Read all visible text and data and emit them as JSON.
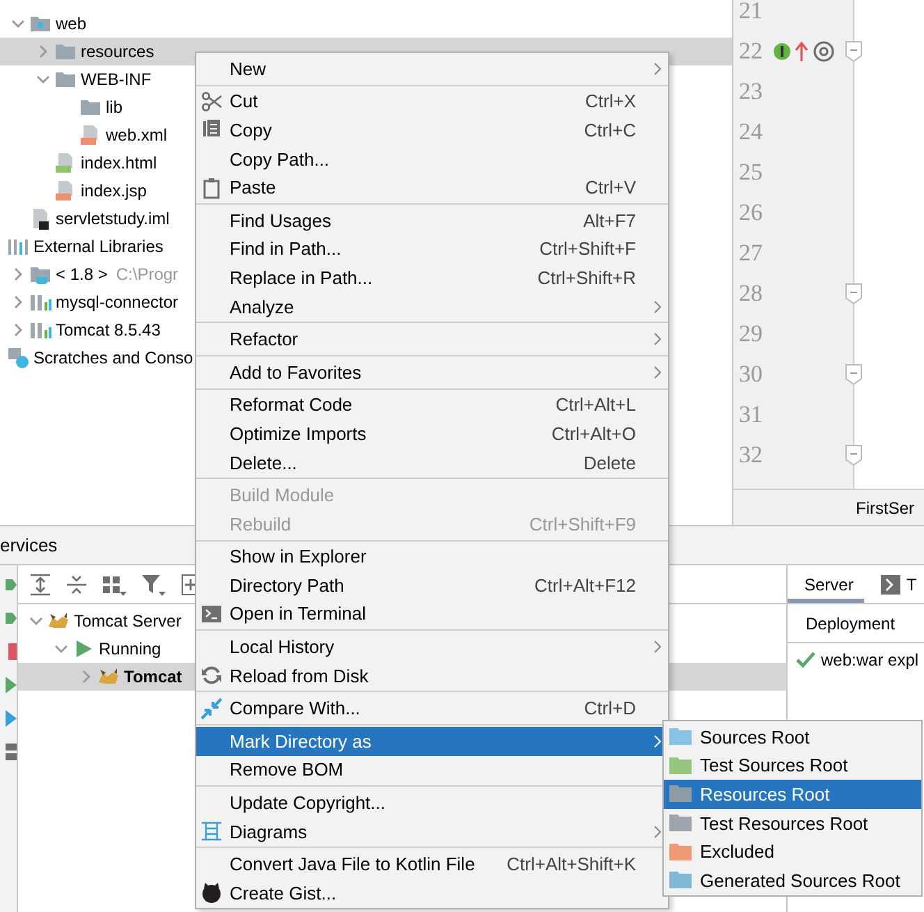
{
  "project_tree": [
    {
      "label": "web",
      "kind": "web-folder",
      "expanded": true,
      "selected": false,
      "children": [
        {
          "label": "resources",
          "kind": "folder",
          "expanded": false,
          "selected": true
        },
        {
          "label": "WEB-INF",
          "kind": "folder",
          "expanded": true,
          "selected": false,
          "children": [
            {
              "label": "lib",
              "kind": "folder",
              "selected": false
            },
            {
              "label": "web.xml",
              "kind": "xml",
              "selected": false
            }
          ]
        },
        {
          "label": "index.html",
          "kind": "html",
          "selected": false
        },
        {
          "label": "index.jsp",
          "kind": "jsp",
          "selected": false
        }
      ]
    },
    {
      "label": "servletstudy.iml",
      "kind": "iml",
      "selected": false
    },
    {
      "label": "External Libraries",
      "kind": "libraries",
      "selected": false,
      "children": [
        {
          "label": "< 1.8 >",
          "detail": "C:\\Progr",
          "kind": "jdk",
          "expanded": false,
          "selected": false
        },
        {
          "label": "mysql-connector",
          "kind": "library",
          "expanded": false,
          "selected": false
        },
        {
          "label": "Tomcat 8.5.43",
          "kind": "library",
          "expanded": false,
          "selected": false
        }
      ]
    },
    {
      "label": "Scratches and Conso",
      "kind": "scratches",
      "selected": false
    }
  ],
  "editor": {
    "lines": [
      {
        "number": "21",
        "fold": false,
        "annotated": false
      },
      {
        "number": "22",
        "fold": true,
        "annotated": true
      },
      {
        "number": "23",
        "fold": false,
        "annotated": false
      },
      {
        "number": "24",
        "fold": false,
        "annotated": false
      },
      {
        "number": "25",
        "fold": false,
        "annotated": false
      },
      {
        "number": "26",
        "fold": false,
        "annotated": false
      },
      {
        "number": "27",
        "fold": false,
        "annotated": false
      },
      {
        "number": "28",
        "fold": true,
        "annotated": false
      },
      {
        "number": "29",
        "fold": false,
        "annotated": false
      },
      {
        "number": "30",
        "fold": true,
        "annotated": false
      },
      {
        "number": "31",
        "fold": false,
        "annotated": false
      },
      {
        "number": "32",
        "fold": true,
        "annotated": false
      }
    ],
    "tab": "FirstSer"
  },
  "services": {
    "title": "ervices",
    "tree": [
      {
        "label": "Tomcat Server",
        "kind": "tomcat",
        "expanded": true,
        "bold": false,
        "selected": false,
        "children": [
          {
            "label": "Running",
            "kind": "running",
            "expanded": true,
            "bold": false,
            "selected": false,
            "children": [
              {
                "label": "Tomcat",
                "kind": "tomcat",
                "expanded": false,
                "bold": true,
                "selected": true
              }
            ]
          }
        ]
      }
    ],
    "tabs": [
      {
        "label": "Server",
        "selected": true
      },
      {
        "label": "T",
        "selected": false
      }
    ],
    "deployment_header": "Deployment",
    "deployments": [
      {
        "label": "web:war expl"
      }
    ]
  },
  "context_menu": {
    "groups": [
      {
        "items": [
          {
            "label": "New",
            "kind": "plain",
            "submenu": true,
            "disabled": false,
            "selected": false
          }
        ]
      },
      {
        "items": [
          {
            "label": "Cut",
            "shortcut": "Ctrl+X",
            "kind": "cut",
            "submenu": false,
            "disabled": false,
            "selected": false
          },
          {
            "label": "Copy",
            "shortcut": "Ctrl+C",
            "kind": "copy",
            "submenu": false,
            "disabled": false,
            "selected": false
          },
          {
            "label": "Copy Path...",
            "kind": "plain",
            "submenu": false,
            "disabled": false,
            "selected": false
          },
          {
            "label": "Paste",
            "shortcut": "Ctrl+V",
            "kind": "paste",
            "submenu": false,
            "disabled": false,
            "selected": false
          }
        ]
      },
      {
        "items": [
          {
            "label": "Find Usages",
            "shortcut": "Alt+F7",
            "kind": "plain",
            "submenu": false,
            "disabled": false,
            "selected": false
          },
          {
            "label": "Find in Path...",
            "shortcut": "Ctrl+Shift+F",
            "kind": "plain",
            "submenu": false,
            "disabled": false,
            "selected": false
          },
          {
            "label": "Replace in Path...",
            "shortcut": "Ctrl+Shift+R",
            "kind": "plain",
            "submenu": false,
            "disabled": false,
            "selected": false
          },
          {
            "label": "Analyze",
            "kind": "plain",
            "submenu": true,
            "disabled": false,
            "selected": false
          }
        ]
      },
      {
        "items": [
          {
            "label": "Refactor",
            "kind": "plain",
            "submenu": true,
            "disabled": false,
            "selected": false
          }
        ]
      },
      {
        "items": [
          {
            "label": "Add to Favorites",
            "kind": "plain",
            "submenu": true,
            "disabled": false,
            "selected": false
          }
        ]
      },
      {
        "items": [
          {
            "label": "Reformat Code",
            "shortcut": "Ctrl+Alt+L",
            "kind": "plain",
            "submenu": false,
            "disabled": false,
            "selected": false
          },
          {
            "label": "Optimize Imports",
            "shortcut": "Ctrl+Alt+O",
            "kind": "plain",
            "submenu": false,
            "disabled": false,
            "selected": false
          },
          {
            "label": "Delete...",
            "shortcut": "Delete",
            "kind": "plain",
            "submenu": false,
            "disabled": false,
            "selected": false
          }
        ]
      },
      {
        "items": [
          {
            "label": "Build Module",
            "kind": "plain",
            "submenu": false,
            "disabled": true,
            "selected": false
          },
          {
            "label": "Rebuild",
            "shortcut": "Ctrl+Shift+F9",
            "kind": "plain",
            "submenu": false,
            "disabled": true,
            "selected": false
          }
        ]
      },
      {
        "items": [
          {
            "label": "Show in Explorer",
            "kind": "plain",
            "submenu": false,
            "disabled": false,
            "selected": false
          },
          {
            "label": "Directory Path",
            "shortcut": "Ctrl+Alt+F12",
            "kind": "plain",
            "submenu": false,
            "disabled": false,
            "selected": false
          },
          {
            "label": "Open in Terminal",
            "kind": "terminal",
            "submenu": false,
            "disabled": false,
            "selected": false
          }
        ]
      },
      {
        "items": [
          {
            "label": "Local History",
            "kind": "plain",
            "submenu": true,
            "disabled": false,
            "selected": false
          },
          {
            "label": "Reload from Disk",
            "kind": "reload",
            "submenu": false,
            "disabled": false,
            "selected": false
          }
        ]
      },
      {
        "items": [
          {
            "label": "Compare With...",
            "shortcut": "Ctrl+D",
            "kind": "compare",
            "submenu": false,
            "disabled": false,
            "selected": false
          }
        ]
      },
      {
        "items": [
          {
            "label": "Mark Directory as",
            "kind": "plain",
            "submenu": true,
            "disabled": false,
            "selected": true
          },
          {
            "label": "Remove BOM",
            "kind": "plain",
            "submenu": false,
            "disabled": false,
            "selected": false
          }
        ]
      },
      {
        "items": [
          {
            "label": "Update Copyright...",
            "kind": "plain",
            "submenu": false,
            "disabled": false,
            "selected": false
          },
          {
            "label": "Diagrams",
            "kind": "diagram",
            "submenu": true,
            "disabled": false,
            "selected": false
          }
        ]
      },
      {
        "items": [
          {
            "label": "Convert Java File to Kotlin File",
            "shortcut": "Ctrl+Alt+Shift+K",
            "kind": "plain",
            "submenu": false,
            "disabled": false,
            "selected": false
          },
          {
            "label": "Create Gist...",
            "kind": "gist",
            "submenu": false,
            "disabled": false,
            "selected": false
          }
        ]
      }
    ]
  },
  "submenu": {
    "items": [
      {
        "label": "Sources Root",
        "color": "#87c3e3",
        "selected": false
      },
      {
        "label": "Test Sources Root",
        "color": "#97c77f",
        "selected": false
      },
      {
        "label": "Resources Root",
        "color": "#8e9aa4",
        "selected": true
      },
      {
        "label": "Test Resources Root",
        "color": "#9da6ad",
        "selected": false
      },
      {
        "label": "Excluded",
        "color": "#f09a73",
        "selected": false
      },
      {
        "label": "Generated Sources Root",
        "color": "#7fb8d8",
        "selected": false
      }
    ]
  }
}
